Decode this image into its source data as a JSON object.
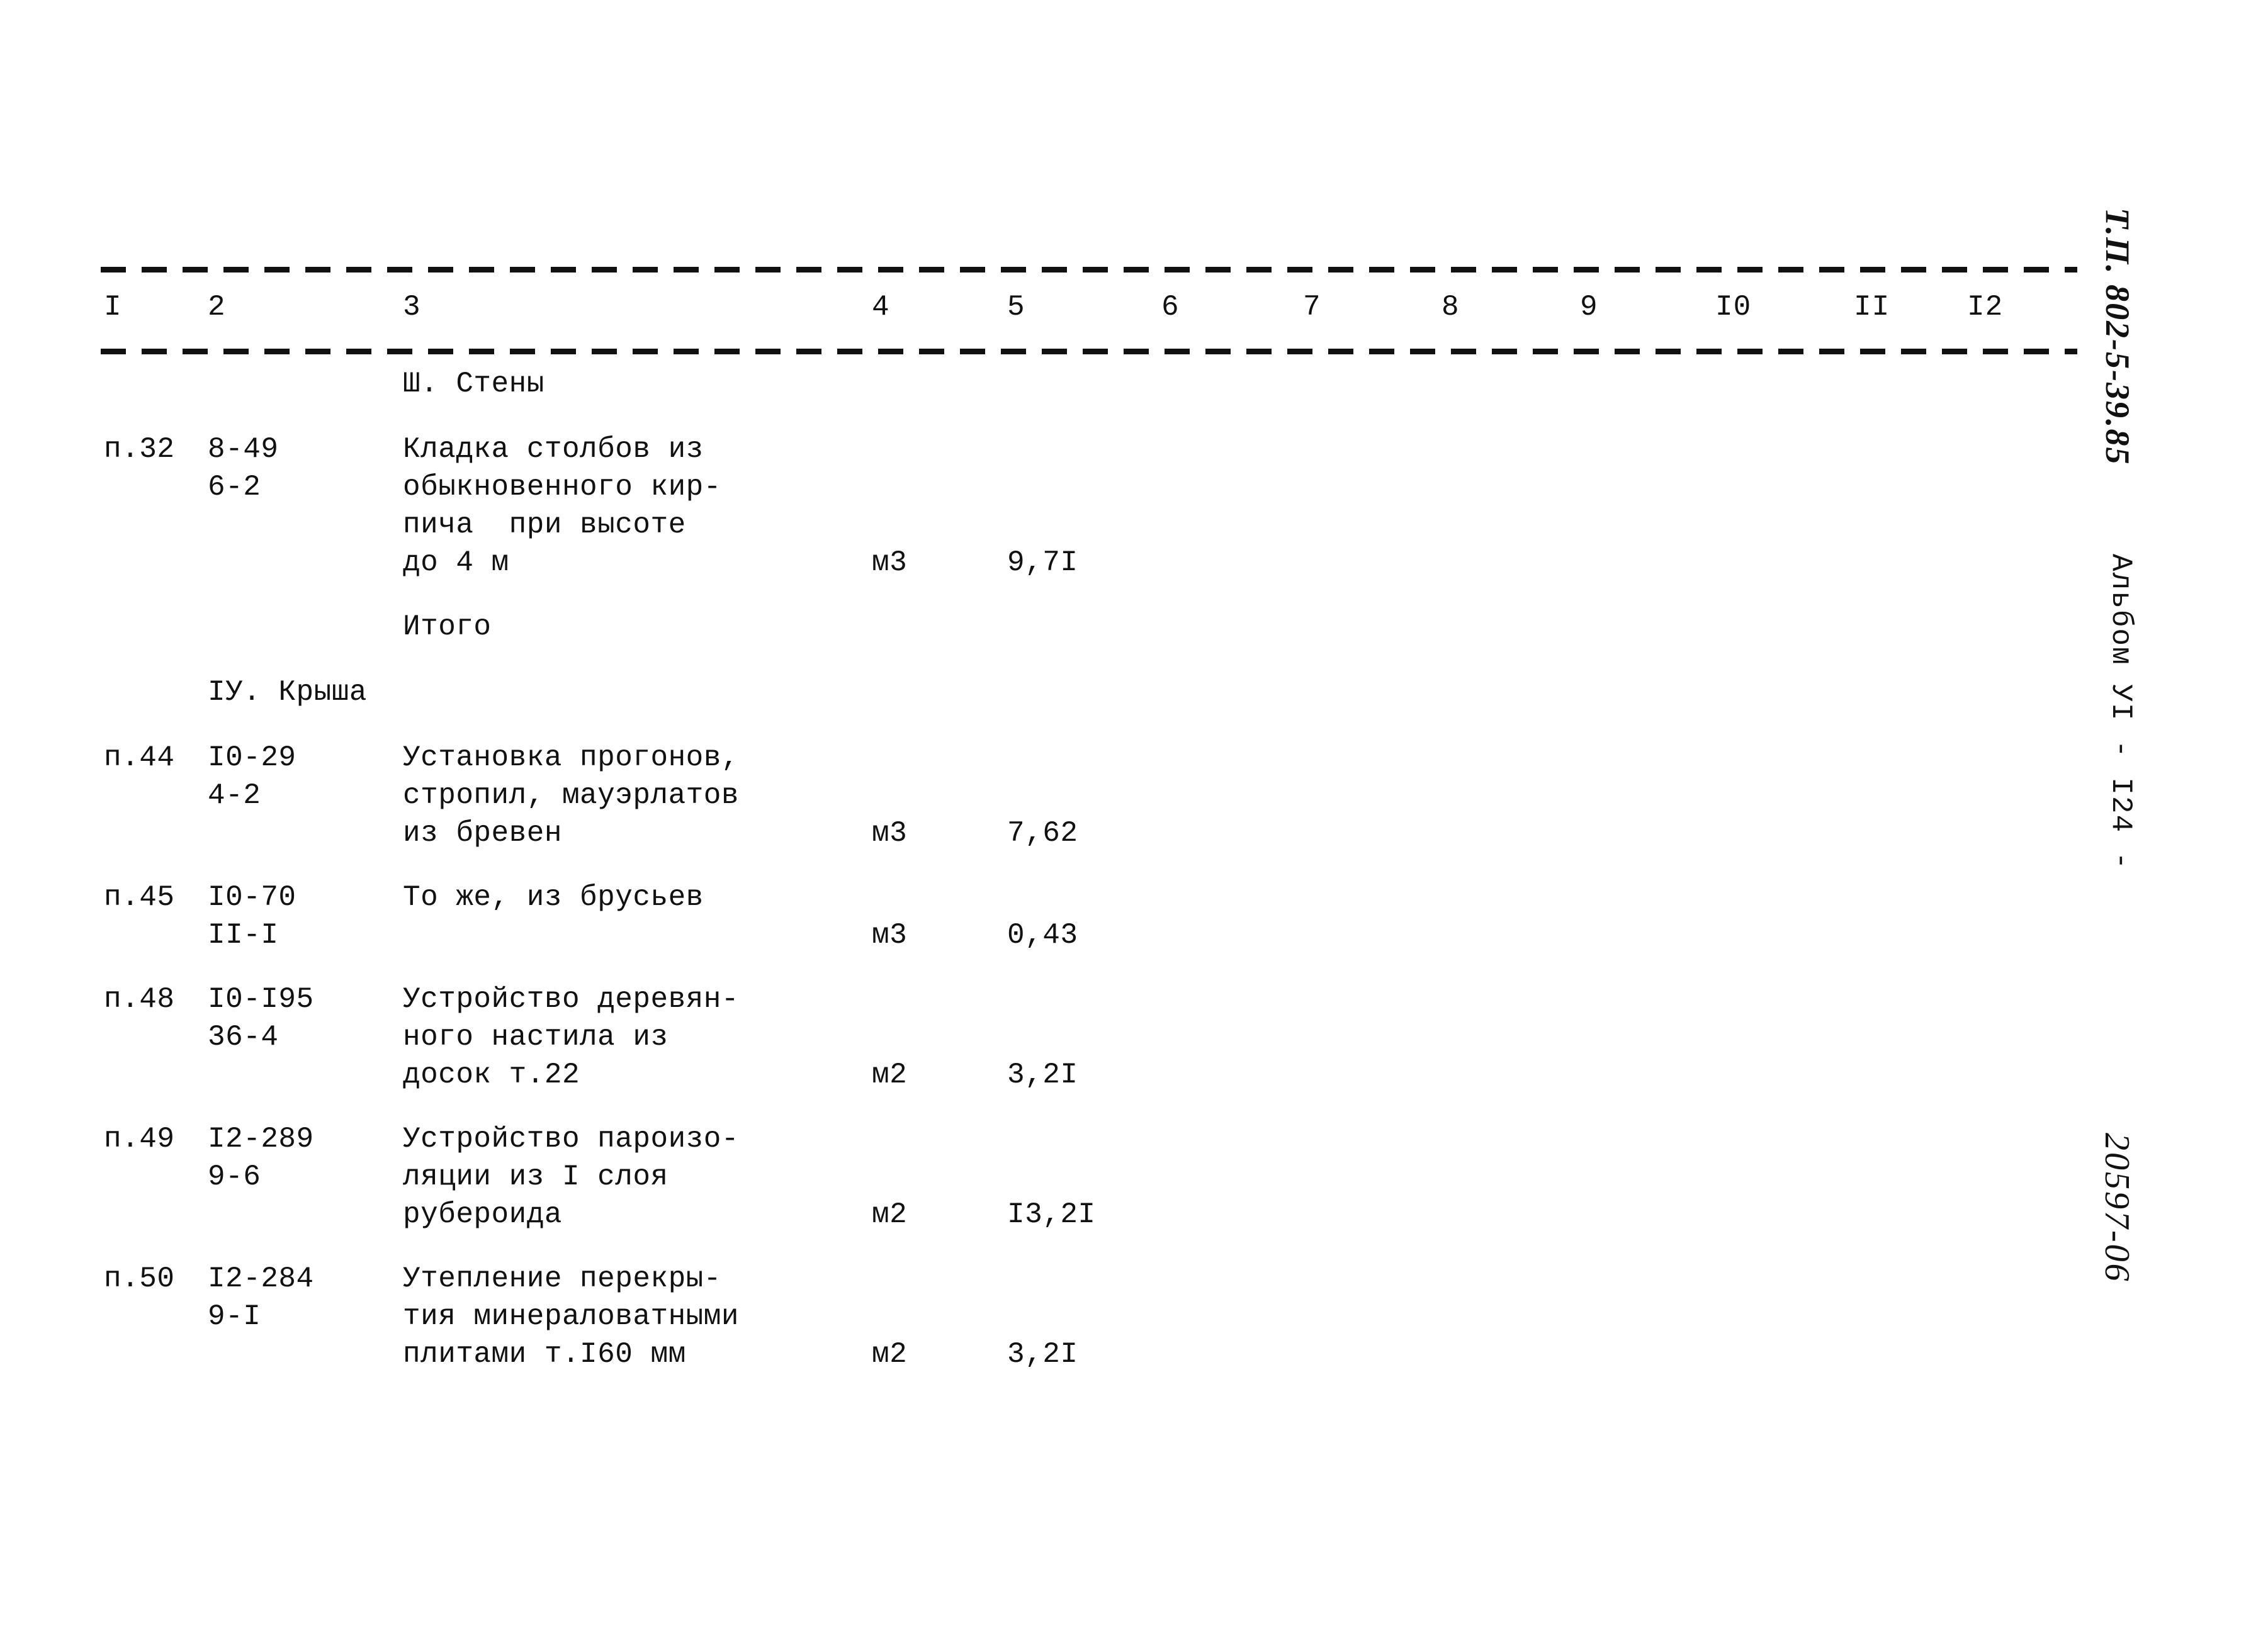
{
  "document": {
    "margin_right": {
      "type_project": "Т.П. 802-5-39.85",
      "album": "Альбом УI   -   I24   -",
      "doc_number": "20597-06"
    }
  },
  "table": {
    "column_numbers": [
      "I",
      "2",
      "3",
      "4",
      "5",
      "6",
      "7",
      "8",
      "9",
      "I0",
      "II",
      "I2"
    ],
    "rows": [
      {
        "kind": "section",
        "title": "Ш. Стены"
      },
      {
        "kind": "item",
        "col1": "п.32",
        "col2_line1": "8-49",
        "col2_line2": "6-2",
        "col3_lines": [
          "Кладка столбов из",
          "обыкновенного кир-",
          "пича  при высоте",
          "до 4 м"
        ],
        "col4": "м3",
        "col5": "9,7I",
        "value_line_index": 3
      },
      {
        "kind": "label",
        "title": "Итого"
      },
      {
        "kind": "section",
        "title": "IУ. Крыша"
      },
      {
        "kind": "item",
        "col1": "п.44",
        "col2_line1": "I0-29",
        "col2_line2": "4-2",
        "col3_lines": [
          "Установка прогонов,",
          "стропил, мауэрлатов",
          "из бревен"
        ],
        "col4": "м3",
        "col5": "7,62",
        "value_line_index": 2
      },
      {
        "kind": "item",
        "col1": "п.45",
        "col2_line1": "I0-70",
        "col2_line2": "II-I",
        "col3_lines": [
          "То же, из брусьев",
          ""
        ],
        "col4": "м3",
        "col5": "0,43",
        "value_line_index": 1
      },
      {
        "kind": "item",
        "col1": "п.48",
        "col2_line1": "I0-I95",
        "col2_line2": "36-4",
        "col3_lines": [
          "Устройство деревян-",
          "ного настила из",
          "досок т.22"
        ],
        "col4": "м2",
        "col5": "3,2I",
        "value_line_index": 2
      },
      {
        "kind": "item",
        "col1": "п.49",
        "col2_line1": "I2-289",
        "col2_line2": "9-6",
        "col3_lines": [
          "Устройство пароизо-",
          "ляции из I слоя",
          "рубероида"
        ],
        "col4": "м2",
        "col5": "I3,2I",
        "value_line_index": 2
      },
      {
        "kind": "item",
        "col1": "п.50",
        "col2_line1": "I2-284",
        "col2_line2": "9-I",
        "col3_lines": [
          "Утепление перекры-",
          "тия минераловатными",
          "плитами т.I60 мм"
        ],
        "col4": "м2",
        "col5": "3,2I",
        "value_line_index": 2
      }
    ]
  }
}
